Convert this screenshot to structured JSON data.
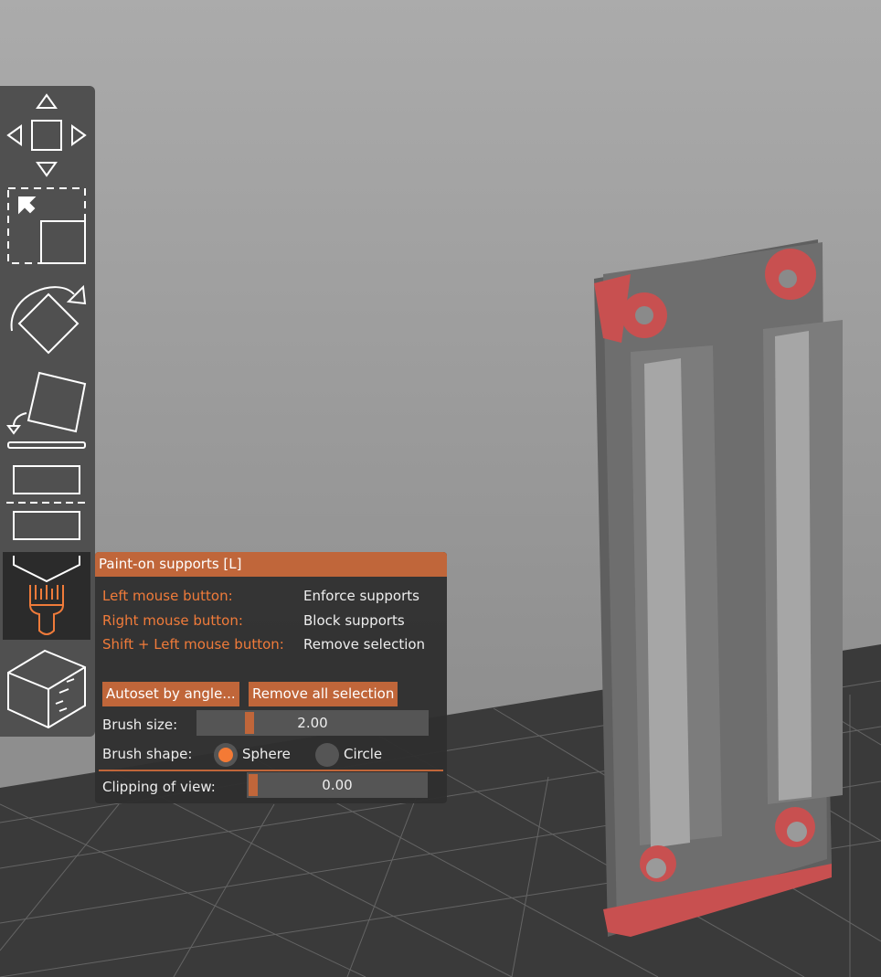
{
  "toolbar": {
    "tools": [
      {
        "name": "move",
        "icon": "move-arrows-icon"
      },
      {
        "name": "scale",
        "icon": "scale-icon"
      },
      {
        "name": "rotate",
        "icon": "rotate-icon"
      },
      {
        "name": "place-on-face",
        "icon": "place-on-face-icon"
      },
      {
        "name": "cut",
        "icon": "cut-icon"
      },
      {
        "name": "paint-supports",
        "icon": "paint-brush-icon",
        "active": true
      },
      {
        "name": "seam-painting",
        "icon": "cube-icon"
      }
    ]
  },
  "panel": {
    "title": "Paint-on supports [L]",
    "hints": [
      {
        "key": "Left mouse button:",
        "action": "Enforce supports"
      },
      {
        "key": "Right mouse button:",
        "action": "Block supports"
      },
      {
        "key": "Shift + Left mouse button:",
        "action": "Remove selection"
      }
    ],
    "autoset_label": "Autoset by angle...",
    "remove_all_label": "Remove all selection",
    "brush_size_label": "Brush size:",
    "brush_size_value": "2.00",
    "brush_shape_label": "Brush shape:",
    "shape_sphere": "Sphere",
    "shape_circle": "Circle",
    "selected_shape": "Sphere",
    "clipping_label": "Clipping of view:",
    "clipping_value": "0.00"
  },
  "colors": {
    "accent": "#c0663a",
    "accent_text": "#f07b3a",
    "enforced": "#c85050"
  }
}
